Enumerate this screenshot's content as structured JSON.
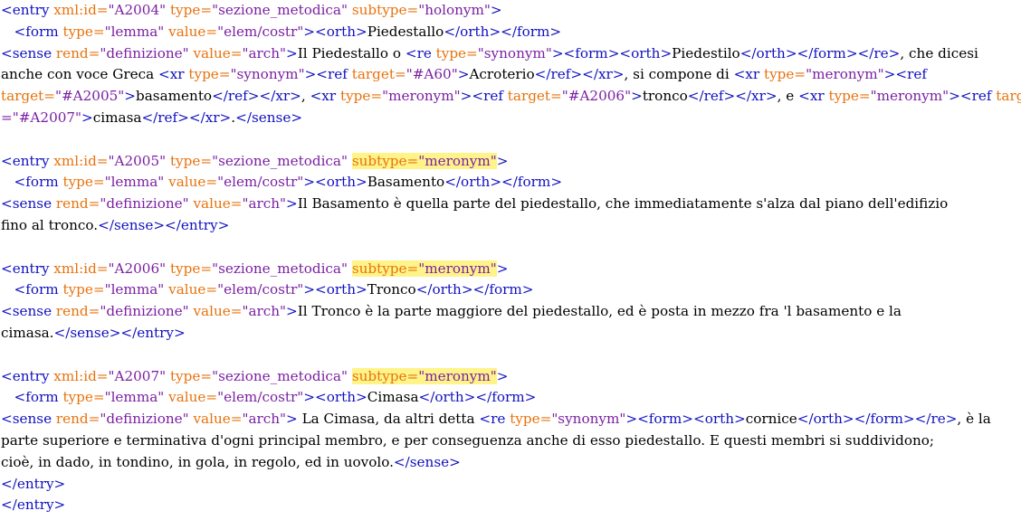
{
  "colors": {
    "tag": "#1010c0",
    "attribute_name": "#e8720c",
    "attribute_value": "#7a1fa2",
    "text": "#000000",
    "highlight": "#fff48a"
  },
  "editor": {
    "lines": [
      {
        "segments": [
          {
            "t": "tag",
            "v": "<entry "
          },
          {
            "t": "attr",
            "v": "xml:id="
          },
          {
            "t": "val",
            "v": "\"A2004\""
          },
          {
            "t": "tag",
            "v": " "
          },
          {
            "t": "attr",
            "v": "type="
          },
          {
            "t": "val",
            "v": "\"sezione_metodica\""
          },
          {
            "t": "tag",
            "v": " "
          },
          {
            "t": "attr",
            "v": "subtype="
          },
          {
            "t": "val",
            "v": "\"holonym\""
          },
          {
            "t": "tag",
            "v": ">"
          }
        ]
      },
      {
        "segments": [
          {
            "t": "txt",
            "v": "   "
          },
          {
            "t": "tag",
            "v": "<form "
          },
          {
            "t": "attr",
            "v": "type="
          },
          {
            "t": "val",
            "v": "\"lemma\""
          },
          {
            "t": "tag",
            "v": " "
          },
          {
            "t": "attr",
            "v": "value="
          },
          {
            "t": "val",
            "v": "\"elem/costr\""
          },
          {
            "t": "tag",
            "v": "><orth>"
          },
          {
            "t": "txt",
            "v": "Piedestallo"
          },
          {
            "t": "tag",
            "v": "</orth></form>"
          }
        ]
      },
      {
        "segments": [
          {
            "t": "tag",
            "v": "<sense "
          },
          {
            "t": "attr",
            "v": "rend="
          },
          {
            "t": "val",
            "v": "\"definizione\""
          },
          {
            "t": "tag",
            "v": " "
          },
          {
            "t": "attr",
            "v": "value="
          },
          {
            "t": "val",
            "v": "\"arch\""
          },
          {
            "t": "tag",
            "v": ">"
          },
          {
            "t": "txt",
            "v": "Il Piedestallo o "
          },
          {
            "t": "tag",
            "v": "<re "
          },
          {
            "t": "attr",
            "v": "type="
          },
          {
            "t": "val",
            "v": "\"synonym\""
          },
          {
            "t": "tag",
            "v": "><form><orth>"
          },
          {
            "t": "txt",
            "v": "Piedestilo"
          },
          {
            "t": "tag",
            "v": "</orth></form></re>"
          },
          {
            "t": "txt",
            "v": ", che dicesi"
          }
        ]
      },
      {
        "segments": [
          {
            "t": "txt",
            "v": "anche con voce Greca "
          },
          {
            "t": "tag",
            "v": "<xr "
          },
          {
            "t": "attr",
            "v": "type="
          },
          {
            "t": "val",
            "v": "\"synonym\""
          },
          {
            "t": "tag",
            "v": "><ref "
          },
          {
            "t": "attr",
            "v": "target="
          },
          {
            "t": "val",
            "v": "\"#A60\""
          },
          {
            "t": "tag",
            "v": ">"
          },
          {
            "t": "txt",
            "v": "Acroterio"
          },
          {
            "t": "tag",
            "v": "</ref></xr>"
          },
          {
            "t": "txt",
            "v": ", si compone di "
          },
          {
            "t": "tag",
            "v": "<xr "
          },
          {
            "t": "attr",
            "v": "type="
          },
          {
            "t": "val",
            "v": "\"meronym\""
          },
          {
            "t": "tag",
            "v": "><ref"
          }
        ]
      },
      {
        "segments": [
          {
            "t": "attr",
            "v": "target="
          },
          {
            "t": "val",
            "v": "\"#A2005\""
          },
          {
            "t": "tag",
            "v": ">"
          },
          {
            "t": "txt",
            "v": "basamento"
          },
          {
            "t": "tag",
            "v": "</ref></xr>"
          },
          {
            "t": "txt",
            "v": ", "
          },
          {
            "t": "tag",
            "v": "<xr "
          },
          {
            "t": "attr",
            "v": "type="
          },
          {
            "t": "val",
            "v": "\"meronym\""
          },
          {
            "t": "tag",
            "v": "><ref "
          },
          {
            "t": "attr",
            "v": "target="
          },
          {
            "t": "val",
            "v": "\"#A2006\""
          },
          {
            "t": "tag",
            "v": ">"
          },
          {
            "t": "txt",
            "v": "tronco"
          },
          {
            "t": "tag",
            "v": "</ref></xr>"
          },
          {
            "t": "txt",
            "v": ", e "
          },
          {
            "t": "tag",
            "v": "<xr "
          },
          {
            "t": "attr",
            "v": "type="
          },
          {
            "t": "val",
            "v": "\"meronym\""
          },
          {
            "t": "tag",
            "v": "><ref "
          },
          {
            "t": "attr",
            "v": "target"
          }
        ]
      },
      {
        "segments": [
          {
            "t": "val",
            "v": "=\"#A2007\""
          },
          {
            "t": "tag",
            "v": ">"
          },
          {
            "t": "txt",
            "v": "cimasa"
          },
          {
            "t": "tag",
            "v": "</ref></xr>"
          },
          {
            "t": "txt",
            "v": "."
          },
          {
            "t": "tag",
            "v": "</sense>"
          }
        ]
      },
      {
        "blank": true,
        "segments": []
      },
      {
        "segments": [
          {
            "t": "tag",
            "v": "<entry "
          },
          {
            "t": "attr",
            "v": "xml:id="
          },
          {
            "t": "val",
            "v": "\"A2005\""
          },
          {
            "t": "tag",
            "v": " "
          },
          {
            "t": "attr",
            "v": "type="
          },
          {
            "t": "val",
            "v": "\"sezione_metodica\""
          },
          {
            "t": "tag",
            "v": " "
          },
          {
            "t": "attr",
            "v": "subtype=",
            "hl": true
          },
          {
            "t": "val",
            "v": "\"meronym\"",
            "hl": true
          },
          {
            "t": "tag",
            "v": ">"
          }
        ]
      },
      {
        "segments": [
          {
            "t": "txt",
            "v": "   "
          },
          {
            "t": "tag",
            "v": "<form "
          },
          {
            "t": "attr",
            "v": "type="
          },
          {
            "t": "val",
            "v": "\"lemma\""
          },
          {
            "t": "tag",
            "v": " "
          },
          {
            "t": "attr",
            "v": "value="
          },
          {
            "t": "val",
            "v": "\"elem/costr\""
          },
          {
            "t": "tag",
            "v": "><orth>"
          },
          {
            "t": "txt",
            "v": "Basamento"
          },
          {
            "t": "tag",
            "v": "</orth></form>"
          }
        ]
      },
      {
        "segments": [
          {
            "t": "tag",
            "v": "<sense "
          },
          {
            "t": "attr",
            "v": "rend="
          },
          {
            "t": "val",
            "v": "\"definizione\""
          },
          {
            "t": "tag",
            "v": " "
          },
          {
            "t": "attr",
            "v": "value="
          },
          {
            "t": "val",
            "v": "\"arch\""
          },
          {
            "t": "tag",
            "v": ">"
          },
          {
            "t": "txt",
            "v": "Il Basamento è quella parte del piedestallo, che immediatamente s'alza dal piano dell'edifizio"
          }
        ]
      },
      {
        "segments": [
          {
            "t": "txt",
            "v": "fino al tronco."
          },
          {
            "t": "tag",
            "v": "</sense></entry>"
          }
        ]
      },
      {
        "blank": true,
        "segments": []
      },
      {
        "segments": [
          {
            "t": "tag",
            "v": "<entry "
          },
          {
            "t": "attr",
            "v": "xml:id="
          },
          {
            "t": "val",
            "v": "\"A2006\""
          },
          {
            "t": "tag",
            "v": " "
          },
          {
            "t": "attr",
            "v": "type="
          },
          {
            "t": "val",
            "v": "\"sezione_metodica\""
          },
          {
            "t": "tag",
            "v": " "
          },
          {
            "t": "attr",
            "v": "subtype=",
            "hl": true
          },
          {
            "t": "val",
            "v": "\"meronym\"",
            "hl": true
          },
          {
            "t": "tag",
            "v": ">"
          }
        ]
      },
      {
        "segments": [
          {
            "t": "txt",
            "v": "   "
          },
          {
            "t": "tag",
            "v": "<form "
          },
          {
            "t": "attr",
            "v": "type="
          },
          {
            "t": "val",
            "v": "\"lemma\""
          },
          {
            "t": "tag",
            "v": " "
          },
          {
            "t": "attr",
            "v": "value="
          },
          {
            "t": "val",
            "v": "\"elem/costr\""
          },
          {
            "t": "tag",
            "v": "><orth>"
          },
          {
            "t": "txt",
            "v": "Tronco"
          },
          {
            "t": "tag",
            "v": "</orth></form>"
          }
        ]
      },
      {
        "segments": [
          {
            "t": "tag",
            "v": "<sense "
          },
          {
            "t": "attr",
            "v": "rend="
          },
          {
            "t": "val",
            "v": "\"definizione\""
          },
          {
            "t": "tag",
            "v": " "
          },
          {
            "t": "attr",
            "v": "value="
          },
          {
            "t": "val",
            "v": "\"arch\""
          },
          {
            "t": "tag",
            "v": ">"
          },
          {
            "t": "txt",
            "v": "Il Tronco è la parte maggiore del piedestallo, ed è posta in mezzo fra 'l basamento e la"
          }
        ]
      },
      {
        "segments": [
          {
            "t": "txt",
            "v": "cimasa."
          },
          {
            "t": "tag",
            "v": "</sense></entry>"
          }
        ]
      },
      {
        "blank": true,
        "segments": []
      },
      {
        "segments": [
          {
            "t": "tag",
            "v": "<entry "
          },
          {
            "t": "attr",
            "v": "xml:id="
          },
          {
            "t": "val",
            "v": "\"A2007\""
          },
          {
            "t": "tag",
            "v": " "
          },
          {
            "t": "attr",
            "v": "type="
          },
          {
            "t": "val",
            "v": "\"sezione_metodica\""
          },
          {
            "t": "tag",
            "v": " "
          },
          {
            "t": "attr",
            "v": "subtype=",
            "hl": true
          },
          {
            "t": "val",
            "v": "\"meronym\"",
            "hl": true
          },
          {
            "t": "tag",
            "v": ">"
          }
        ]
      },
      {
        "segments": [
          {
            "t": "txt",
            "v": "   "
          },
          {
            "t": "tag",
            "v": "<form "
          },
          {
            "t": "attr",
            "v": "type="
          },
          {
            "t": "val",
            "v": "\"lemma\""
          },
          {
            "t": "tag",
            "v": " "
          },
          {
            "t": "attr",
            "v": "value="
          },
          {
            "t": "val",
            "v": "\"elem/costr\""
          },
          {
            "t": "tag",
            "v": "><orth>"
          },
          {
            "t": "txt",
            "v": "Cimasa"
          },
          {
            "t": "tag",
            "v": "</orth></form>"
          }
        ]
      },
      {
        "segments": [
          {
            "t": "tag",
            "v": "<sense "
          },
          {
            "t": "attr",
            "v": "rend="
          },
          {
            "t": "val",
            "v": "\"definizione\""
          },
          {
            "t": "tag",
            "v": " "
          },
          {
            "t": "attr",
            "v": "value="
          },
          {
            "t": "val",
            "v": "\"arch\""
          },
          {
            "t": "tag",
            "v": ">"
          },
          {
            "t": "txt",
            "v": " La Cimasa, da altri detta "
          },
          {
            "t": "tag",
            "v": "<re "
          },
          {
            "t": "attr",
            "v": "type="
          },
          {
            "t": "val",
            "v": "\"synonym\""
          },
          {
            "t": "tag",
            "v": "><form><orth>"
          },
          {
            "t": "txt",
            "v": "cornice"
          },
          {
            "t": "tag",
            "v": "</orth></form></re>"
          },
          {
            "t": "txt",
            "v": ", è la"
          }
        ]
      },
      {
        "segments": [
          {
            "t": "txt",
            "v": "parte superiore e terminativa d'ogni principal membro, e per conseguenza anche di esso piedestallo. E questi membri si suddividono;"
          }
        ]
      },
      {
        "segments": [
          {
            "t": "txt",
            "v": "cioè, in dado, in tondino, in gola, in regolo, ed in uovolo."
          },
          {
            "t": "tag",
            "v": "</sense>"
          }
        ]
      },
      {
        "segments": [
          {
            "t": "tag",
            "v": "</entry>"
          }
        ]
      },
      {
        "segments": [
          {
            "t": "tag",
            "v": "</entry>"
          }
        ]
      }
    ]
  }
}
